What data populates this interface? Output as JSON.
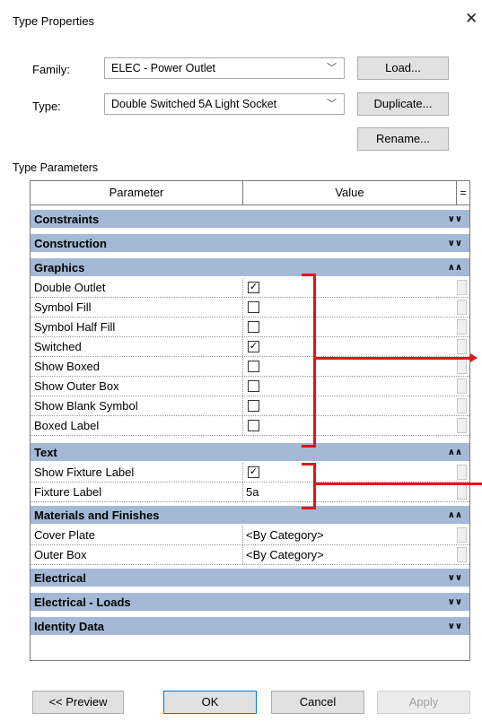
{
  "dialog": {
    "title": "Type Properties",
    "close": "✕"
  },
  "family": {
    "label": "Family:",
    "value": "ELEC - Power Outlet"
  },
  "type": {
    "label": "Type:",
    "value": "Double Switched 5A Light Socket"
  },
  "buttons": {
    "load": "Load...",
    "duplicate": "Duplicate...",
    "rename": "Rename..."
  },
  "type_parameters_label": "Type Parameters",
  "grid_header": {
    "parameter": "Parameter",
    "value": "Value",
    "eq": "="
  },
  "groups": {
    "constraints": "Constraints",
    "construction": "Construction",
    "graphics": "Graphics",
    "text": "Text",
    "materials": "Materials and Finishes",
    "electrical": "Electrical",
    "electrical_loads": "Electrical - Loads",
    "identity": "Identity Data"
  },
  "toggle": {
    "collapsed": "»",
    "expanded": "«"
  },
  "graphics_params": [
    {
      "name": "Double Outlet",
      "checked": true
    },
    {
      "name": "Symbol Fill",
      "checked": false
    },
    {
      "name": "Symbol Half Fill",
      "checked": false
    },
    {
      "name": "Switched",
      "checked": true
    },
    {
      "name": "Show Boxed",
      "checked": false
    },
    {
      "name": "Show Outer Box",
      "checked": false
    },
    {
      "name": "Show Blank Symbol",
      "checked": false
    },
    {
      "name": "Boxed Label",
      "checked": false
    }
  ],
  "text_params": [
    {
      "name": "Show Fixture Label",
      "checked": true
    },
    {
      "name": "Fixture Label",
      "value": "5a"
    }
  ],
  "materials_params": [
    {
      "name": "Cover Plate",
      "value": "<By Category>"
    },
    {
      "name": "Outer Box",
      "value": "<By Category>"
    }
  ],
  "footer": {
    "preview": "<< Preview",
    "ok": "OK",
    "cancel": "Cancel",
    "apply": "Apply"
  },
  "check_mark": "✓",
  "colors": {
    "group_header": "#a3b9d6",
    "annotation": "#e3131b"
  }
}
